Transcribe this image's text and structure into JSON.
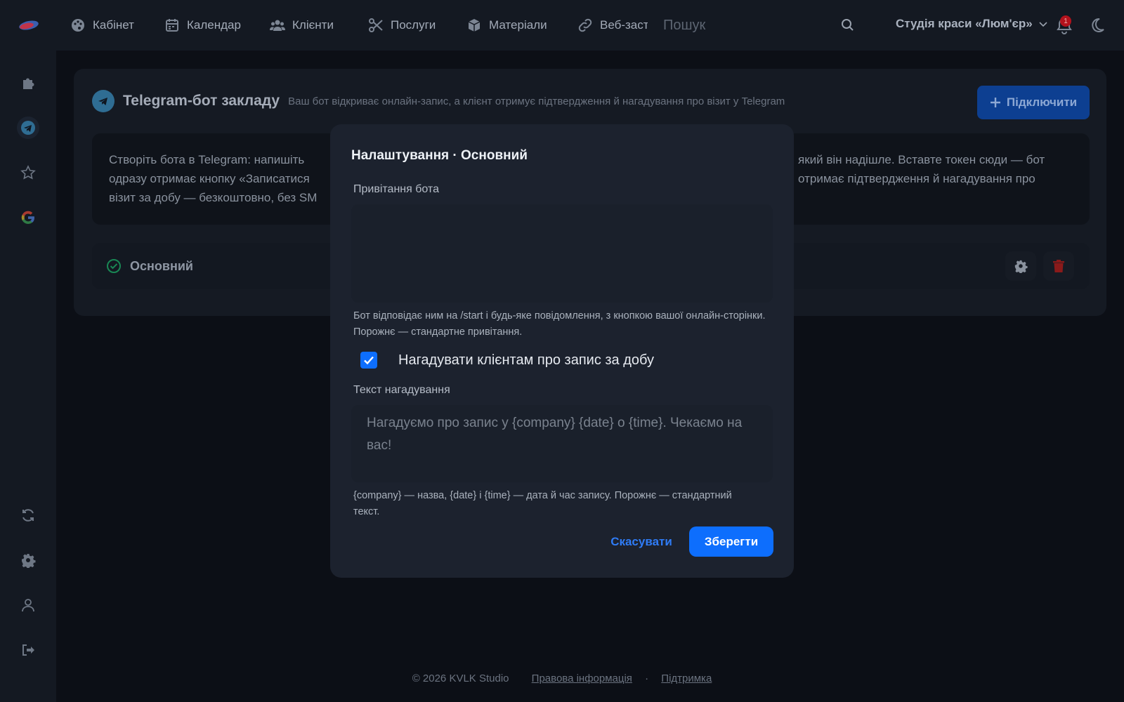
{
  "topnav": {
    "items": [
      {
        "label": "Кабінет",
        "icon": "palette-icon"
      },
      {
        "label": "Календар",
        "icon": "calendar-icon"
      },
      {
        "label": "Клієнти",
        "icon": "users-icon"
      },
      {
        "label": "Послуги",
        "icon": "scissors-icon"
      },
      {
        "label": "Матеріали",
        "icon": "box-icon"
      },
      {
        "label": "Веб-заст",
        "icon": "link-icon"
      }
    ],
    "search_placeholder": "Пошук",
    "studio_name": "Студія краси «Люм'єр»",
    "notification_count": "1"
  },
  "sidebar": {
    "icons": [
      "puzzle-icon",
      "telegram-icon",
      "star-icon",
      "google-icon",
      "sync-icon",
      "gear-icon",
      "user-icon",
      "logout-icon"
    ]
  },
  "panel": {
    "title": "Telegram-бот закладу",
    "subtitle": "Ваш бот відкриває онлайн-запис, а клієнт отримує підтвердження й нагадування про візит у Telegram",
    "connect_label": "Підключити",
    "info_left": [
      "Створіть бота в Telegram: напишіть",
      "одразу отримає кнопку «Записатися",
      "візит за добу — безкоштовно, без SM"
    ],
    "info_right": [
      "який він надішле. Вставте токен сюди — бот",
      "отримає підтвердження й нагадування про"
    ],
    "bot_name": "Основний"
  },
  "modal": {
    "title": "Налаштування · Основний",
    "greeting_label": "Привітання бота",
    "greeting_value": "",
    "greeting_hint": "Бот відповідає ним на /start і будь-яке повідомлення, з кнопкою вашої онлайн-сторінки. Порожнє — стандартне привітання.",
    "reminder_checkbox_label": "Нагадувати клієнтам про запис за добу",
    "reminder_checked": true,
    "reminder_text_label": "Текст нагадування",
    "reminder_placeholder": "Нагадуємо про запис у {company} {date} о {time}. Чекаємо на вас!",
    "reminder_hint": "{company} — назва, {date} і {time} — дата й час запису. Порожнє — стандартний текст.",
    "cancel_label": "Скасувати",
    "save_label": "Зберегти"
  },
  "footer": {
    "copyright": "© 2026 KVLK Studio",
    "legal_link": "Правова інформація",
    "separator": "·",
    "support_link": "Підтримка"
  },
  "colors": {
    "accent": "#0d6efd",
    "danger": "#b3121c",
    "success": "#198754",
    "telegram": "#2f6d93"
  }
}
